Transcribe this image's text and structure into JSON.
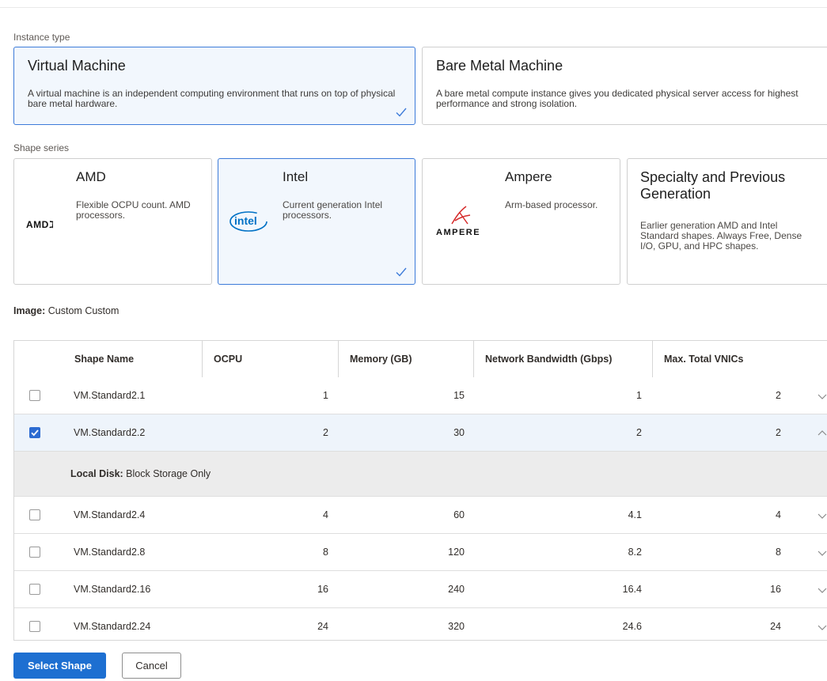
{
  "instance_type": {
    "label": "Instance type",
    "options": [
      {
        "title": "Virtual Machine",
        "description": "A virtual machine is an independent computing environment that runs on top of physical bare metal hardware.",
        "selected": true
      },
      {
        "title": "Bare Metal Machine",
        "description": "A bare metal compute instance gives you dedicated physical server access for highest performance and strong isolation.",
        "selected": false
      }
    ]
  },
  "shape_series": {
    "label": "Shape series",
    "options": [
      {
        "title": "AMD",
        "description": "Flexible OCPU count. AMD processors.",
        "logo_text": "AMDℷ",
        "selected": false
      },
      {
        "title": "Intel",
        "description": "Current generation Intel processors.",
        "logo_text": "intel",
        "selected": true
      },
      {
        "title": "Ampere",
        "description": "Arm-based processor.",
        "logo_text": "AMPERE",
        "selected": false
      },
      {
        "title": "Specialty and Previous Generation",
        "description": "Earlier generation AMD and Intel Standard shapes. Always Free, Dense I/O, GPU, and HPC shapes.",
        "selected": false
      }
    ]
  },
  "image": {
    "label": "Image:",
    "value": "Custom Custom"
  },
  "table": {
    "columns": [
      "Shape Name",
      "OCPU",
      "Memory (GB)",
      "Network Bandwidth (Gbps)",
      "Max. Total VNICs"
    ],
    "rows": [
      {
        "name": "VM.Standard2.1",
        "ocpu": "1",
        "memory": "15",
        "bandwidth": "1",
        "vnics": "2",
        "checked": false,
        "expanded": false
      },
      {
        "name": "VM.Standard2.2",
        "ocpu": "2",
        "memory": "30",
        "bandwidth": "2",
        "vnics": "2",
        "checked": true,
        "expanded": true
      },
      {
        "name": "VM.Standard2.4",
        "ocpu": "4",
        "memory": "60",
        "bandwidth": "4.1",
        "vnics": "4",
        "checked": false,
        "expanded": false
      },
      {
        "name": "VM.Standard2.8",
        "ocpu": "8",
        "memory": "120",
        "bandwidth": "8.2",
        "vnics": "8",
        "checked": false,
        "expanded": false
      },
      {
        "name": "VM.Standard2.16",
        "ocpu": "16",
        "memory": "240",
        "bandwidth": "16.4",
        "vnics": "16",
        "checked": false,
        "expanded": false
      },
      {
        "name": "VM.Standard2.24",
        "ocpu": "24",
        "memory": "320",
        "bandwidth": "24.6",
        "vnics": "24",
        "checked": false,
        "expanded": false
      }
    ],
    "detail": {
      "label": "Local Disk:",
      "value": "Block Storage Only"
    }
  },
  "buttons": {
    "select_label": "Select Shape",
    "cancel_label": "Cancel"
  },
  "colors": {
    "accent": "#1d6fd1",
    "selected_border": "#3d7bd9",
    "selected_bg": "#f2f7fd"
  },
  "icons": {
    "check": "checkmark-icon",
    "expand": "chevron-down-icon",
    "collapse": "chevron-up-icon"
  }
}
